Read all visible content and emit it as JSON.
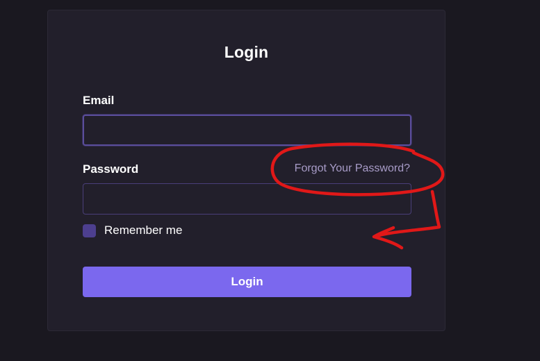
{
  "form": {
    "title": "Login",
    "email_label": "Email",
    "email_value": "",
    "password_label": "Password",
    "password_value": "",
    "forgot_password_label": "Forgot Your Password?",
    "remember_label": "Remember me",
    "remember_checked": false,
    "submit_label": "Login"
  },
  "colors": {
    "background": "#1a1820",
    "card": "#221f2b",
    "accent": "#7b68ee",
    "link": "#a89cc8",
    "annotation": "#e01818"
  }
}
